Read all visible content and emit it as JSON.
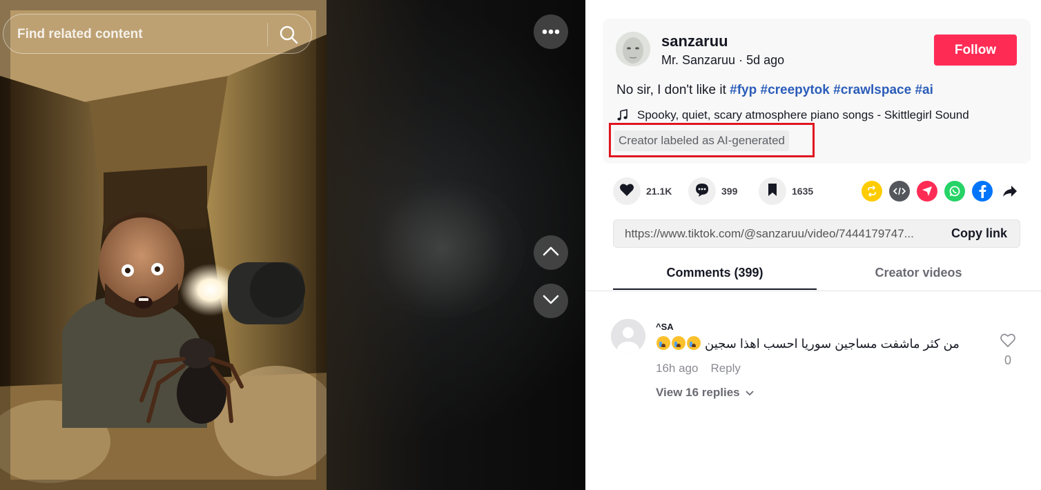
{
  "search": {
    "placeholder": "Find related content"
  },
  "video": {
    "scene": "man in tunnel with giant spider",
    "icons": [
      "more-icon",
      "chevron-up-icon",
      "chevron-down-icon",
      "search-icon"
    ]
  },
  "post": {
    "username": "sanzaruu",
    "nickname": "Mr. Sanzaruu",
    "separator": " · ",
    "posted": "5d ago",
    "follow_label": "Follow",
    "description": "No sir, I don't like it ",
    "hashtags": [
      "#fyp",
      "#creepytok",
      "#crawlspace",
      "#ai"
    ],
    "music": "Spooky, quiet, scary atmosphere piano songs - Skittlegirl Sound",
    "ai_label": "Creator labeled as AI-generated"
  },
  "stats": {
    "likes": "21.1K",
    "comments": "399",
    "saves": "1635"
  },
  "share_icons": [
    "repost-icon",
    "embed-icon",
    "send-icon",
    "whatsapp-icon",
    "facebook-icon",
    "share-arrow-icon"
  ],
  "colors": {
    "follow": "#fe2c55",
    "hashtag": "#2b5db9",
    "highlight": "#e0141e",
    "repost": "#fecc00",
    "embed": "#54575c",
    "send": "#fe2c55",
    "whatsapp": "#25d366",
    "facebook": "#0075fa"
  },
  "link": {
    "url": "https://www.tiktok.com/@sanzaruu/video/7444179747...",
    "copy_label": "Copy link"
  },
  "tabs": {
    "comments": "Comments (399)",
    "creator_videos": "Creator videos"
  },
  "comment": {
    "user": "^SA",
    "text": "من كثر ماشفت مساجين سوريا احسب اهذا سجين",
    "time": "16h ago",
    "reply_label": "Reply",
    "view_replies": "View 16 replies",
    "likes": "0"
  }
}
